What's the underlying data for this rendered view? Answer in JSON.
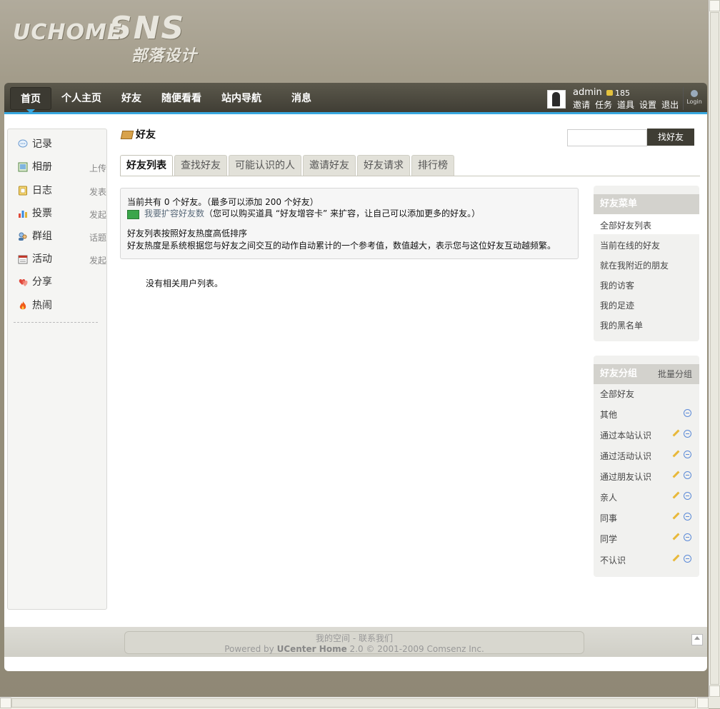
{
  "logo": {
    "line1": "UCHOME",
    "line2": "SNS",
    "line3": "部落设计"
  },
  "nav": {
    "items": [
      "首页",
      "个人主页",
      "好友",
      "随便看看",
      "站内导航"
    ],
    "message": "消息"
  },
  "user": {
    "name": "admin",
    "credits": "185",
    "links": [
      "邀请",
      "任务",
      "道具",
      "设置",
      "退出"
    ],
    "login_label": "Login"
  },
  "sidebar": {
    "items": [
      {
        "label": "记录",
        "extra": "",
        "icon": "chat-bubble-icon"
      },
      {
        "label": "相册",
        "extra": "上传",
        "icon": "photo-album-icon"
      },
      {
        "label": "日志",
        "extra": "发表",
        "icon": "blog-icon"
      },
      {
        "label": "投票",
        "extra": "发起",
        "icon": "poll-chart-icon"
      },
      {
        "label": "群组",
        "extra": "话题",
        "icon": "group-icon"
      },
      {
        "label": "活动",
        "extra": "发起",
        "icon": "calendar-icon"
      },
      {
        "label": "分享",
        "extra": "",
        "icon": "heart-share-icon"
      },
      {
        "label": "热闹",
        "extra": "",
        "icon": "fire-icon"
      }
    ]
  },
  "page": {
    "title": "好友",
    "search_button": "找好友"
  },
  "tabs": [
    "好友列表",
    "查找好友",
    "可能认识的人",
    "邀请好友",
    "好友请求",
    "排行榜"
  ],
  "info": {
    "line1": "当前共有  0 个好友。（最多可以添加  200 个好友）",
    "expand_link": "我要扩容好友数",
    "expand_note": "（您可以购买道具 “好友增容卡” 来扩容，让自己可以添加更多的好友。）",
    "line3": "好友列表按照好友热度高低排序",
    "line4": "好友热度是系统根据您与好友之间交互的动作自动累计的一个参考值，数值越大，表示您与这位好友互动越频繁。"
  },
  "empty_text": "没有相关用户列表。",
  "friend_menu": {
    "title": "好友菜单",
    "items": [
      "全部好友列表",
      "当前在线的好友",
      "就在我附近的朋友",
      "我的访客",
      "我的足迹",
      "我的黑名单"
    ]
  },
  "friend_groups": {
    "title": "好友分组",
    "batch": "批量分组",
    "all": "全部好友",
    "items": [
      "其他",
      "通过本站认识",
      "通过活动认识",
      "通过朋友认识",
      "亲人",
      "同事",
      "同学",
      "不认识"
    ]
  },
  "footer": {
    "link1": "我的空间",
    "link2": "联系我们",
    "separator": " - ",
    "powered_prefix": "Powered by ",
    "product": "UCenter Home",
    "version": " 2.0 © 2001-2009 Comsenz Inc."
  },
  "colors": {
    "nav_accent": "#38a8e0",
    "nav_bg": "#3f3d34",
    "page_bg": "#a39c8a"
  }
}
